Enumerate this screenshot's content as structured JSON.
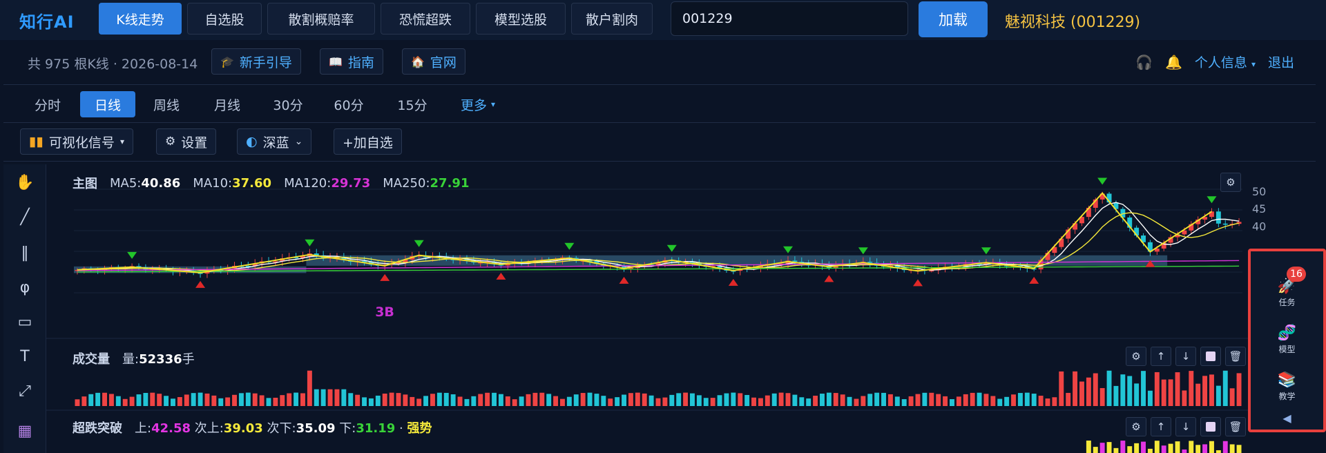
{
  "app": {
    "logo": "知行AI",
    "nav_tabs": [
      "K线走势",
      "自选股",
      "散割概赔率",
      "恐慌超跌",
      "模型选股",
      "散户割肉"
    ],
    "active_nav": "K线走势",
    "search_value": "001229",
    "load_label": "加载",
    "stock_name": "魅视科技 (001229)"
  },
  "info_bar": {
    "bars_count": "共 975 根K线 · 2026-08-14",
    "guide_newbie": "新手引导",
    "guide": "指南",
    "official": "官网",
    "profile": "个人信息",
    "logout": "退出"
  },
  "periods": {
    "items": [
      "分时",
      "日线",
      "周线",
      "月线",
      "30分",
      "60分",
      "15分",
      "更多"
    ],
    "active": "日线"
  },
  "toolbar": {
    "visual_signal": "可视化信号",
    "settings": "设置",
    "theme": "深蓝",
    "add_watch": "+加自选"
  },
  "main_panel": {
    "title": "主图",
    "ma5_label": "MA5:",
    "ma5": "40.86",
    "ma10_label": "MA10:",
    "ma10": "37.60",
    "ma120_label": "MA120:",
    "ma120": "29.73",
    "ma250_label": "MA250:",
    "ma250": "27.91",
    "annotation_3b": "3B"
  },
  "volume_panel": {
    "title": "成交量",
    "vol_label": "量:",
    "vol_value": "52336",
    "vol_unit": "手"
  },
  "signal_panel": {
    "title": "超跌突破",
    "up_label": "上:",
    "up": "42.58",
    "next_up_label": "次上:",
    "next_up": "39.03",
    "next_down_label": "次下:",
    "next_down": "35.09",
    "down_label": "下:",
    "down": "31.19",
    "strength": "强势"
  },
  "side_widget": {
    "task": "任务",
    "task_badge": "16",
    "model": "模型",
    "teach": "教学"
  },
  "colors": {
    "accent": "#2a7bde",
    "up": "#ef4444",
    "down": "#22c5d6",
    "ma5": "#ffffff",
    "ma10": "#f5e93b",
    "ma120": "#d633d6",
    "ma250": "#39d339",
    "signal_up": "#e335e3",
    "signal_next_up": "#f5e93b",
    "signal_down": "#39d339",
    "strength": "#f5e93b"
  },
  "chart_data": {
    "type": "candlestick",
    "y_ticks_main": [
      50,
      45,
      40
    ],
    "zigzag_price_points": [
      {
        "i": 0,
        "p": 27.4
      },
      {
        "i": 8,
        "p": 28.2
      },
      {
        "i": 18,
        "p": 26.6
      },
      {
        "i": 34,
        "p": 31.8
      },
      {
        "i": 45,
        "p": 28.6
      },
      {
        "i": 50,
        "p": 31.6
      },
      {
        "i": 62,
        "p": 29.0
      },
      {
        "i": 72,
        "p": 30.8
      },
      {
        "i": 80,
        "p": 27.8
      },
      {
        "i": 87,
        "p": 30.2
      },
      {
        "i": 96,
        "p": 27.2
      },
      {
        "i": 104,
        "p": 29.8
      },
      {
        "i": 110,
        "p": 28.3
      },
      {
        "i": 115,
        "p": 29.5
      },
      {
        "i": 123,
        "p": 27.1
      },
      {
        "i": 133,
        "p": 29.5
      },
      {
        "i": 140,
        "p": 27.8
      },
      {
        "i": 150,
        "p": 49.5
      },
      {
        "i": 157,
        "p": 32.6
      },
      {
        "i": 166,
        "p": 44.2
      }
    ],
    "buy_markers": [
      18,
      45,
      62,
      80,
      96,
      110,
      123,
      140,
      157
    ],
    "sell_markers": [
      8,
      34,
      50,
      72,
      87,
      104,
      115,
      133,
      150,
      166
    ],
    "consolidation_boxes": [
      {
        "from": 0,
        "to": 34,
        "low": 26.5,
        "high": 28.4
      },
      {
        "from": 34,
        "to": 160,
        "low": 28.6,
        "high": 31.6
      }
    ]
  }
}
